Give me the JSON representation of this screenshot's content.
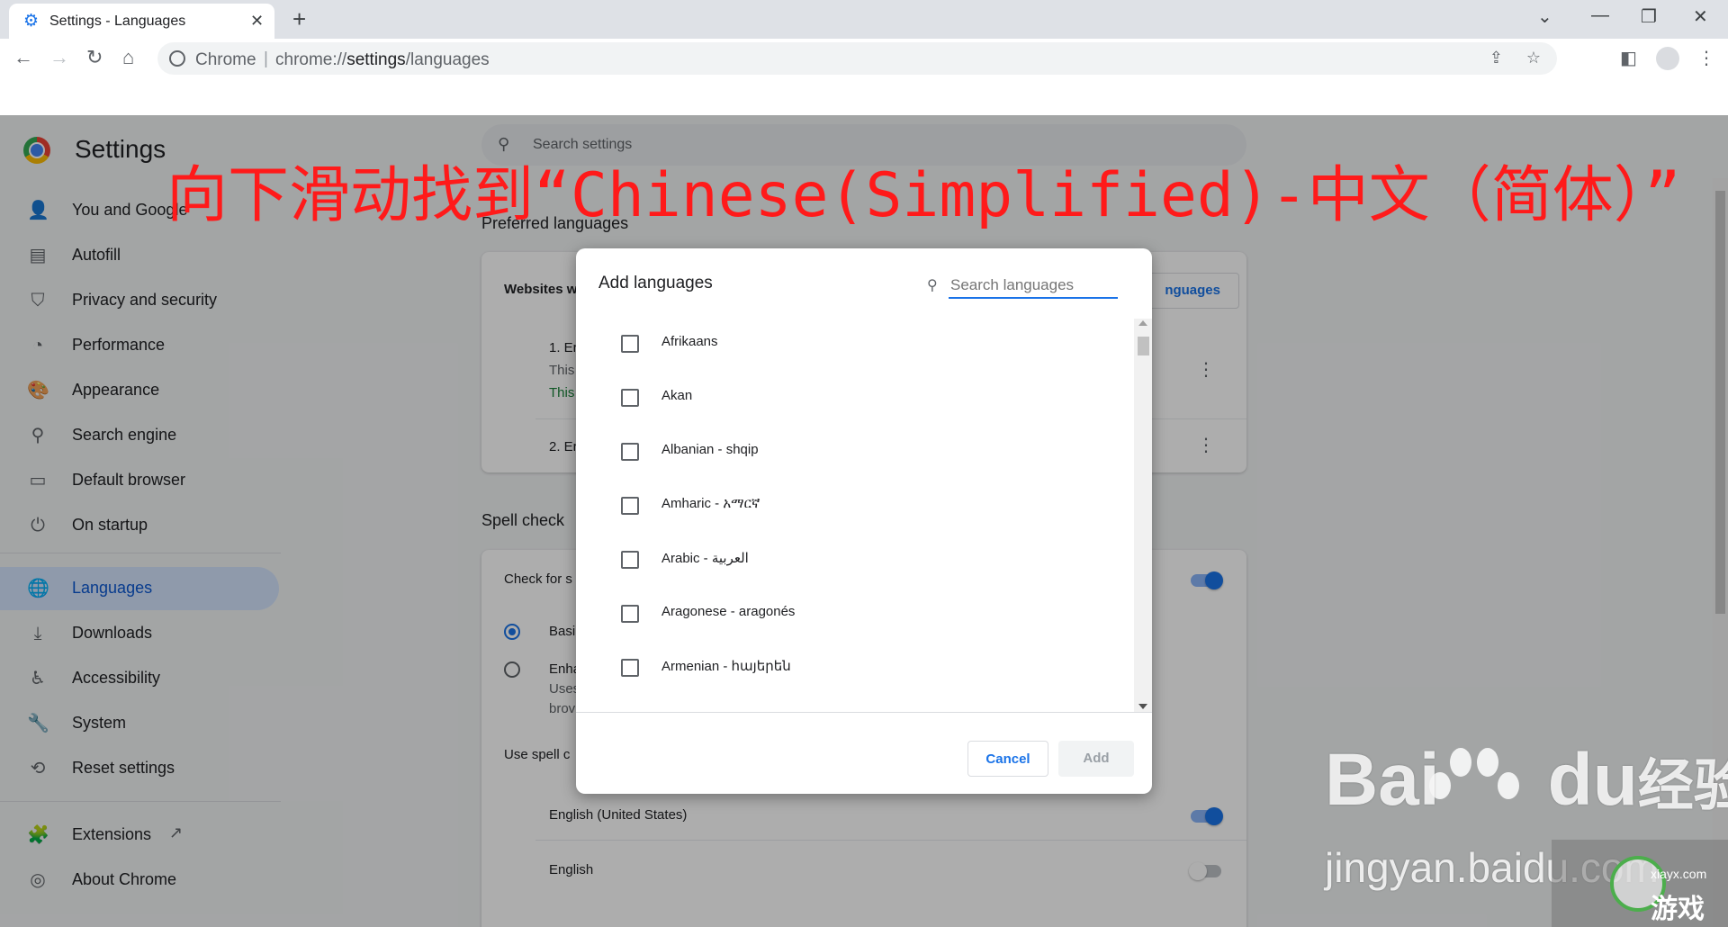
{
  "browser": {
    "tab_title": "Settings - Languages",
    "omnibox_site": "Chrome",
    "omnibox_sep": "|",
    "omnibox_url_scheme": "chrome://",
    "omnibox_url_main": "settings",
    "omnibox_url_path": "/languages"
  },
  "settings": {
    "title": "Settings",
    "search_placeholder": "Search settings",
    "nav": [
      {
        "label": "You and Google",
        "icon": "person-icon"
      },
      {
        "label": "Autofill",
        "icon": "clipboard-icon"
      },
      {
        "label": "Privacy and security",
        "icon": "shield-icon"
      },
      {
        "label": "Performance",
        "icon": "speedometer-icon"
      },
      {
        "label": "Appearance",
        "icon": "palette-icon"
      },
      {
        "label": "Search engine",
        "icon": "search-icon"
      },
      {
        "label": "Default browser",
        "icon": "browser-icon"
      },
      {
        "label": "On startup",
        "icon": "power-icon"
      },
      {
        "label": "Languages",
        "icon": "globe-icon",
        "active": true
      },
      {
        "label": "Downloads",
        "icon": "download-icon"
      },
      {
        "label": "Accessibility",
        "icon": "accessibility-icon"
      },
      {
        "label": "System",
        "icon": "wrench-icon"
      },
      {
        "label": "Reset settings",
        "icon": "history-icon"
      },
      {
        "label": "Extensions",
        "icon": "puzzle-icon"
      },
      {
        "label": "About Chrome",
        "icon": "chrome-icon"
      }
    ],
    "preferred_languages": {
      "heading": "Preferred languages",
      "websites_label": "Websites w",
      "add_button_partial": "nguages",
      "lang1_title": "1. Er",
      "lang1_sub": "This",
      "lang1_note": "This",
      "lang2_title": "2. Er"
    },
    "spell_check": {
      "heading": "Spell check",
      "check_for": "Check for s",
      "basic": "Basi",
      "enhanced": "Enha",
      "enhanced_sub1": "Uses",
      "enhanced_sub2": "brov",
      "use_spell": "Use spell c",
      "lang_a": "English (United States)",
      "lang_b": "English"
    }
  },
  "dialog": {
    "title": "Add languages",
    "search_placeholder": "Search languages",
    "languages": [
      "Afrikaans",
      "Akan",
      "Albanian - shqip",
      "Amharic - አማርኛ",
      "Arabic - العربية",
      "Aragonese - aragonés",
      "Armenian - հայերեն"
    ],
    "cancel_label": "Cancel",
    "add_label": "Add"
  },
  "overlay": {
    "instruction": "向下滑动找到“Chinese(Simplified)-中文（简体）”"
  },
  "watermarks": {
    "baidu": "Bai",
    "baidu_du": "du",
    "baidu_jy": "经验",
    "jingyan": "jingyan.baidu.com",
    "site": "xiayx.com",
    "game": "游戏"
  },
  "colors": {
    "accent": "#1a73e8",
    "overlay_red": "#ff1a1a"
  }
}
